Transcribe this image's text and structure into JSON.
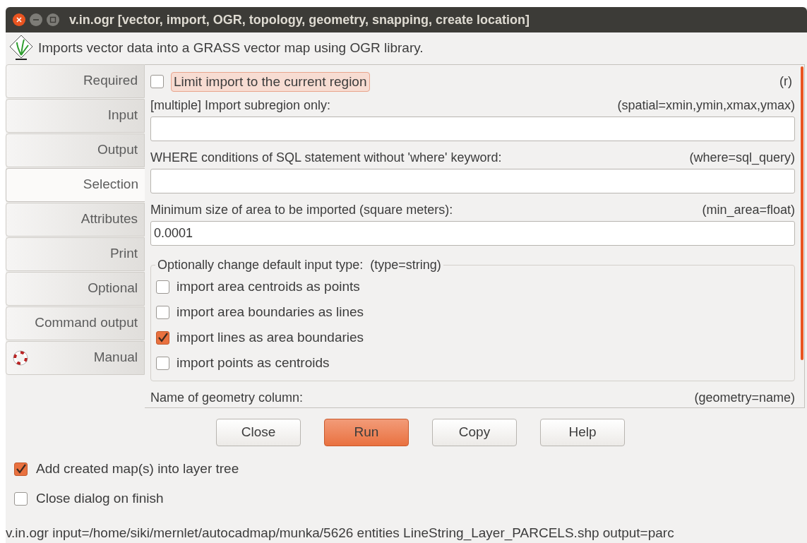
{
  "window": {
    "title": "v.in.ogr [vector, import, OGR, topology, geometry, snapping, create location]"
  },
  "description": "Imports vector data into a GRASS vector map using OGR library.",
  "tabs": [
    {
      "label": "Required",
      "selected": false,
      "kind": "plain"
    },
    {
      "label": "Input",
      "selected": false,
      "kind": "plain"
    },
    {
      "label": "Output",
      "selected": false,
      "kind": "plain"
    },
    {
      "label": "Selection",
      "selected": true,
      "kind": "plain"
    },
    {
      "label": "Attributes",
      "selected": false,
      "kind": "plain"
    },
    {
      "label": "Print",
      "selected": false,
      "kind": "plain"
    },
    {
      "label": "Optional",
      "selected": false,
      "kind": "plain"
    },
    {
      "label": "Command output",
      "selected": false,
      "kind": "plain"
    },
    {
      "label": "Manual",
      "selected": false,
      "kind": "manual"
    }
  ],
  "limit_region": {
    "label": "Limit import to the current region",
    "checked": false,
    "flag": "(r)"
  },
  "fields": [
    {
      "label": "[multiple] Import subregion only:",
      "param": "(spatial=xmin,ymin,xmax,ymax)"
    },
    {
      "label": "WHERE conditions of SQL statement without 'where' keyword:",
      "param": "(where=sql_query)"
    },
    {
      "label": "Minimum size of area to be imported (square meters):",
      "param": "(min_area=float)",
      "value": "0.0001"
    }
  ],
  "type_group": {
    "legend": "Optionally change default input type:",
    "param": "(type=string)",
    "options": [
      {
        "label": "import area centroids as points",
        "checked": false
      },
      {
        "label": "import area boundaries as lines",
        "checked": false
      },
      {
        "label": "import lines as area boundaries",
        "checked": true
      },
      {
        "label": "import points as centroids",
        "checked": false
      }
    ]
  },
  "geometry_field": {
    "label": "Name of geometry column:",
    "param": "(geometry=name)"
  },
  "buttons": [
    {
      "label": "Close",
      "kind": "normal"
    },
    {
      "label": "Run",
      "kind": "primary"
    },
    {
      "label": "Copy",
      "kind": "normal"
    },
    {
      "label": "Help",
      "kind": "normal"
    }
  ],
  "options": [
    {
      "label": "Add created map(s) into layer tree",
      "checked": true
    },
    {
      "label": "Close dialog on finish",
      "checked": false
    }
  ],
  "command": "v.in.ogr input=/home/siki/mernlet/autocadmap/munka/5626 entities LineString_Layer_PARCELS.shp output=parc"
}
